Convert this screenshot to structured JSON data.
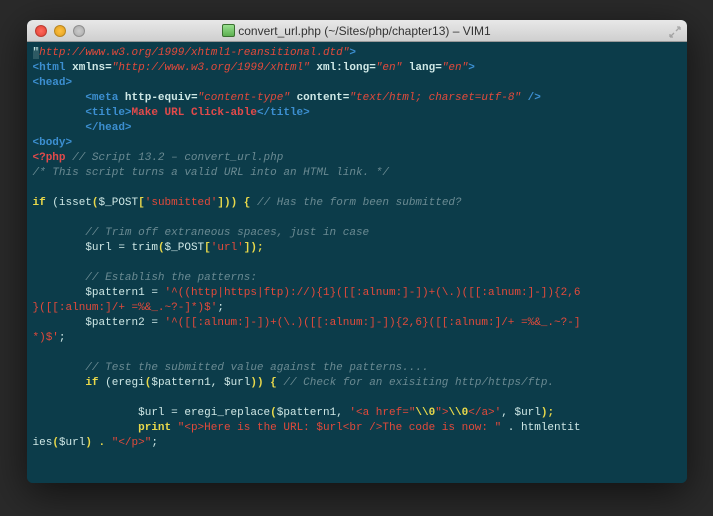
{
  "titlebar": {
    "close": "",
    "minimize": "",
    "maximize": "",
    "doc_icon": "php",
    "title": "convert_url.php (~/Sites/php/chapter13) – VIM1"
  },
  "code": {
    "l1_dtd": "\"http://www.w3.org/1999/xhtml1-reansitional.dtd\"",
    "l1_close": ">",
    "l2_tag_open": "<html",
    "l2_attr1": " xmlns=",
    "l2_val1": "\"http://www.w3.org/1999/xhtml\"",
    "l2_attr2": " xml:long=",
    "l2_val2": "\"en\"",
    "l2_attr3": " lang=",
    "l2_val3": "\"en\"",
    "l2_close": ">",
    "l3": "<head>",
    "l4_indent": "        ",
    "l4_tag": "<meta",
    "l4_attr1": " http-equiv=",
    "l4_val1": "\"content-type\"",
    "l4_attr2": " content=",
    "l4_val2": "\"text/html; charset=utf-8\"",
    "l4_close": " />",
    "l5_indent": "        ",
    "l5_open": "<title>",
    "l5_text": "Make URL Click-able",
    "l5_close": "</title>",
    "l6_indent": "        ",
    "l6": "</head>",
    "l7": "<body>",
    "l8_php": "<?php",
    "l8_c": " // Script 13.2 – convert_url.php",
    "l9": "/* This script turns a valid URL into an HTML link. */",
    "l11_if": "if",
    "l11_p1": " (",
    "l11_fn": "isset",
    "l11_p2": "(",
    "l11_var": "$_POST",
    "l11_br1": "[",
    "l11_key": "'submitted'",
    "l11_br2": "])) {",
    "l11_c": " // Has the form been submitted?",
    "l13_c": "        // Trim off extraneous spaces, just in case",
    "l14_indent": "        ",
    "l14_var": "$url",
    "l14_eq": " = ",
    "l14_fn": "trim",
    "l14_p1": "(",
    "l14_gv": "$_POST",
    "l14_br1": "[",
    "l14_key": "'url'",
    "l14_br2": "]);",
    "l16_c": "        // Establish the patterns:",
    "l17_indent": "        ",
    "l17_var": "$pattern1",
    "l17_eq": " = ",
    "l17_val": "'^((http|https|ftp)://){1}([[:alnum:]-])+(\\.)([[:alnum:]-]){2,6",
    "l18": "}([[:alnum:]/+ =%&_.~?-]*)$'",
    "l18_semi": ";",
    "l19_indent": "        ",
    "l19_var": "$pattern2",
    "l19_eq": " = ",
    "l19_val": "'^([[:alnum:]-])+(\\.)([[:alnum:]-]){2,6}([[:alnum:]/+ =%&_.~?-]",
    "l20": "*)$'",
    "l20_semi": ";",
    "l22_c": "        // Test the submitted value against the patterns....",
    "l23_indent": "        ",
    "l23_if": "if",
    "l23_p1": " (",
    "l23_fn": "eregi",
    "l23_p2": "(",
    "l23_a1": "$pattern1",
    "l23_comma": ", ",
    "l23_a2": "$url",
    "l23_p3": ")) {",
    "l23_c": " // Check for an exisiting http/https/ftp.",
    "l25_indent": "                ",
    "l25_var": "$url",
    "l25_eq": " = ",
    "l25_fn": "eregi_replace",
    "l25_p1": "(",
    "l25_a1": "$pattern1",
    "l25_c1": ", ",
    "l25_s1": "'<a href=\"",
    "l25_esc1": "\\\\0",
    "l25_s2": "\">",
    "l25_esc2": "\\\\0",
    "l25_s3": "</a>'",
    "l25_c2": ", ",
    "l25_a3": "$url",
    "l25_p2": ");",
    "l26_indent": "                ",
    "l26_print": "print",
    "l26_sp": " ",
    "l26_str": "\"<p>Here is the URL: $url<br />The code is now: \"",
    "l26_cat": " . ",
    "l26_fn": "htmlentit",
    "l27_fn": "ies",
    "l27_p1": "(",
    "l27_a": "$url",
    "l27_p2": ") . ",
    "l27_s": "\"</p>\"",
    "l27_semi": ";"
  }
}
